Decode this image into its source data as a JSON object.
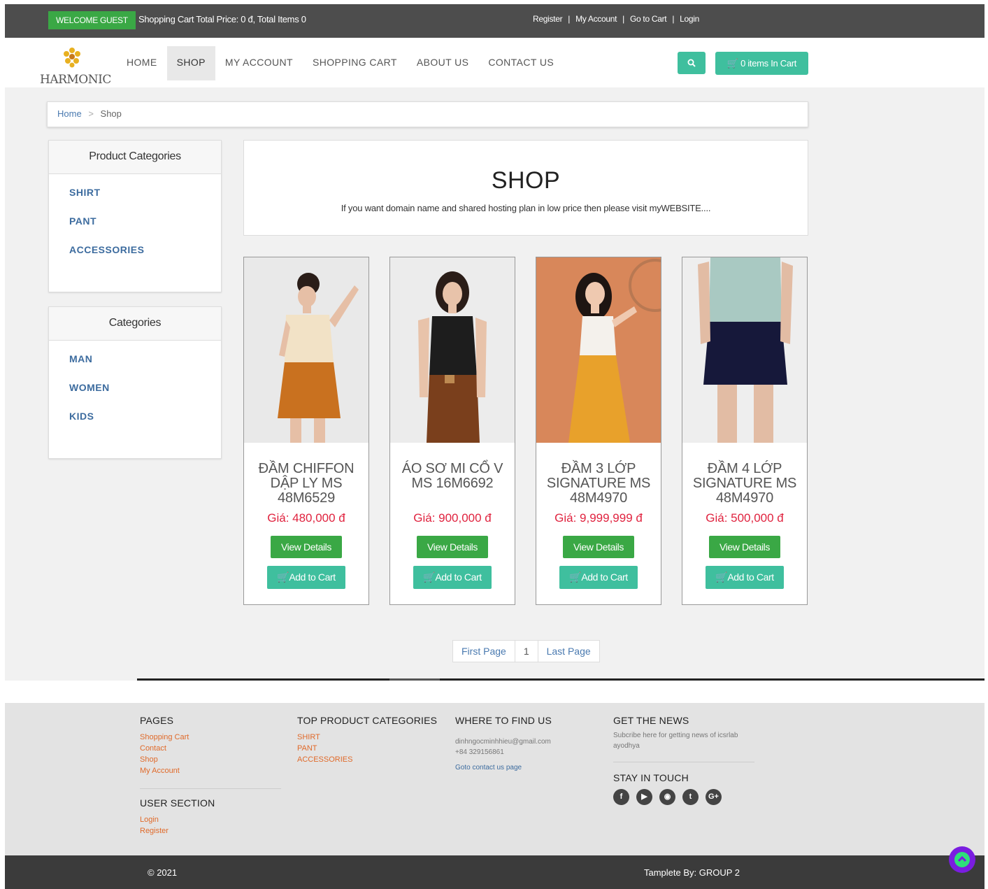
{
  "topbar": {
    "welcome": "WELCOME GUEST",
    "cart_summary": "Shopping Cart Total Price: 0 đ, Total Items 0",
    "links": [
      "Register",
      "My Account",
      "Go to Cart",
      "Login"
    ]
  },
  "header": {
    "logo_text": "HARMONIC",
    "nav": [
      "HOME",
      "SHOP",
      "MY ACCOUNT",
      "SHOPPING CART",
      "ABOUT US",
      "CONTACT US"
    ],
    "active_nav": "SHOP",
    "search_icon": "search-icon",
    "cart_button": "0 items In Cart"
  },
  "breadcrumb": {
    "home": "Home",
    "separator": ">",
    "current": "Shop"
  },
  "sidebar": {
    "product_categories": {
      "title": "Product Categories",
      "items": [
        "SHIRT",
        "PANT",
        "ACCESSORIES"
      ]
    },
    "categories": {
      "title": "Categories",
      "items": [
        "MAN",
        "WOMEN",
        "KIDS"
      ]
    }
  },
  "shop": {
    "title": "SHOP",
    "subtitle": "If you want domain name and shared hosting plan in low price then please visit myWEBSITE...."
  },
  "products": [
    {
      "name": "ĐẦM CHIFFON DẬP LY MS 48M6529",
      "price": "Giá: 480,000 đ",
      "view": "View Details",
      "add": "Add to Cart"
    },
    {
      "name": "ÁO SƠ MI CỔ V MS 16M6692",
      "price": "Giá: 900,000 đ",
      "view": "View Details",
      "add": "Add to Cart"
    },
    {
      "name": "ĐẦM 3 LỚP SIGNATURE MS 48M4970",
      "price": "Giá: 9,999,999 đ",
      "view": "View Details",
      "add": "Add to Cart"
    },
    {
      "name": "ĐẦM 4 LỚP SIGNATURE MS 48M4970",
      "price": "Giá: 500,000 đ",
      "view": "View Details",
      "add": "Add to Cart"
    }
  ],
  "pagination": {
    "first": "First Page",
    "current": "1",
    "last": "Last Page"
  },
  "footer": {
    "pages": {
      "title": "PAGES",
      "links": [
        "Shopping Cart",
        "Contact",
        "Shop",
        "My Account"
      ]
    },
    "user_section": {
      "title": "USER SECTION",
      "links": [
        "Login",
        "Register"
      ]
    },
    "top_categories": {
      "title": "TOP PRODUCT CATEGORIES",
      "links": [
        "SHIRT",
        "PANT",
        "ACCESSORIES"
      ]
    },
    "find_us": {
      "title": "WHERE TO FIND US",
      "email": "dinhngocminhhieu@gmail.com",
      "phone": "+84 329156861",
      "contact_link": "Goto contact us page"
    },
    "news": {
      "title": "GET THE NEWS",
      "text": "Subcribe here for getting news of icsrlab ayodhya"
    },
    "touch": {
      "title": "STAY IN TOUCH",
      "icons": [
        "facebook-icon",
        "youtube-icon",
        "instagram-icon",
        "twitter-icon",
        "google-plus-icon"
      ]
    }
  },
  "bottom": {
    "copyright": "© 2021",
    "credit": "Tamplete By: GROUP 2"
  },
  "colors": {
    "topbar": "#4d4d4d",
    "green": "#3aa845",
    "teal": "#3fbf9e",
    "price": "#e0233f",
    "link": "#3d6c9f",
    "footer_link": "#e06a2a"
  }
}
